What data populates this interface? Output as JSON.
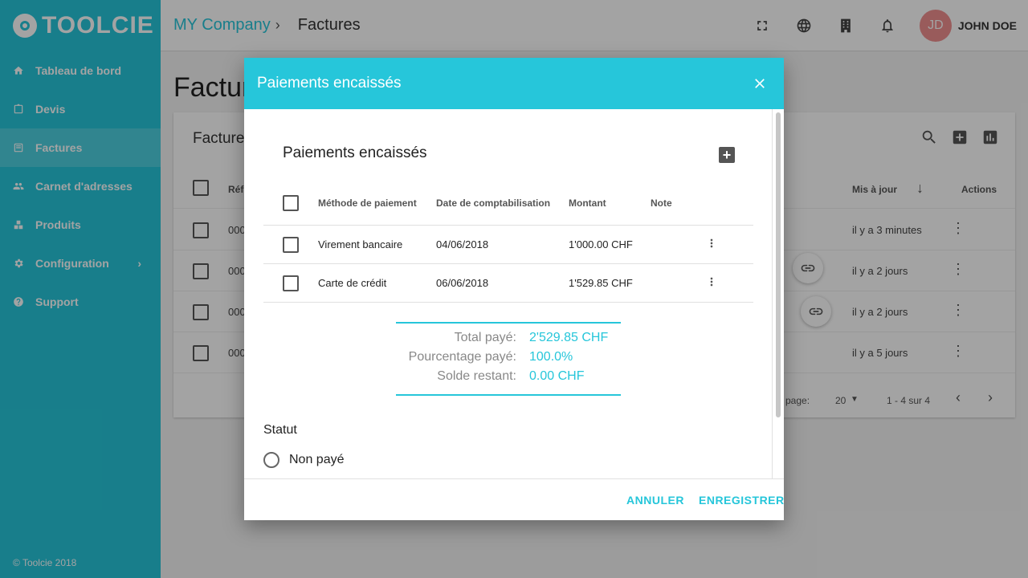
{
  "brand": {
    "name": "TOOLCIE",
    "primary": "#26c6da"
  },
  "sidebar": {
    "items": [
      {
        "label": "Tableau de bord",
        "icon": "home-icon"
      },
      {
        "label": "Devis",
        "icon": "quote-icon"
      },
      {
        "label": "Factures",
        "icon": "invoice-icon",
        "active": true
      },
      {
        "label": "Carnet d'adresses",
        "icon": "people-icon"
      },
      {
        "label": "Produits",
        "icon": "products-icon"
      },
      {
        "label": "Configuration",
        "icon": "gear-icon",
        "chevron": "›"
      },
      {
        "label": "Support",
        "icon": "help-icon"
      }
    ],
    "footer": "© Toolcie 2018"
  },
  "topbar": {
    "company": "MY Company",
    "separator": "›",
    "page": "Factures",
    "icons": [
      "fullscreen-icon",
      "globe-icon",
      "building-icon",
      "bell-icon"
    ],
    "avatar_initials": "JD",
    "user_name": "JOHN DOE"
  },
  "background": {
    "page_title": "Factures",
    "card_title": "Factures",
    "header": {
      "ref": "Réf",
      "updated": "Mis à jour",
      "actions": "Actions",
      "sort_arrow": "↓"
    },
    "rows": [
      {
        "ref": "000",
        "updated": "il y a 3 minutes"
      },
      {
        "ref": "000",
        "updated": "il y a 2 jours"
      },
      {
        "ref": "000",
        "updated": "il y a 2 jours"
      },
      {
        "ref": "000",
        "updated": "il y a 5 jours"
      }
    ],
    "pager": {
      "per_page_label": "page:",
      "per_page": "20",
      "range": "1 - 4 sur 4"
    }
  },
  "dialog": {
    "title": "Paiements encaissés",
    "inner_title": "Paiements encaissés",
    "add_label": "+",
    "columns": {
      "method": "Méthode de paiement",
      "date": "Date de comptabilisation",
      "amount": "Montant",
      "note": "Note"
    },
    "rows": [
      {
        "method": "Virement bancaire",
        "date": "04/06/2018",
        "amount": "1'000.00 CHF",
        "note": ""
      },
      {
        "method": "Carte de crédit",
        "date": "06/06/2018",
        "amount": "1'529.85 CHF",
        "note": ""
      }
    ],
    "summary": {
      "total_label": "Total payé:",
      "total_value": "2'529.85 CHF",
      "percent_label": "Pourcentage payé:",
      "percent_value": "100.0%",
      "balance_label": "Solde restant:",
      "balance_value": "0.00 CHF"
    },
    "status": {
      "label": "Statut",
      "option": "Non payé"
    },
    "cancel": "ANNULER",
    "save": "ENREGISTRER"
  }
}
